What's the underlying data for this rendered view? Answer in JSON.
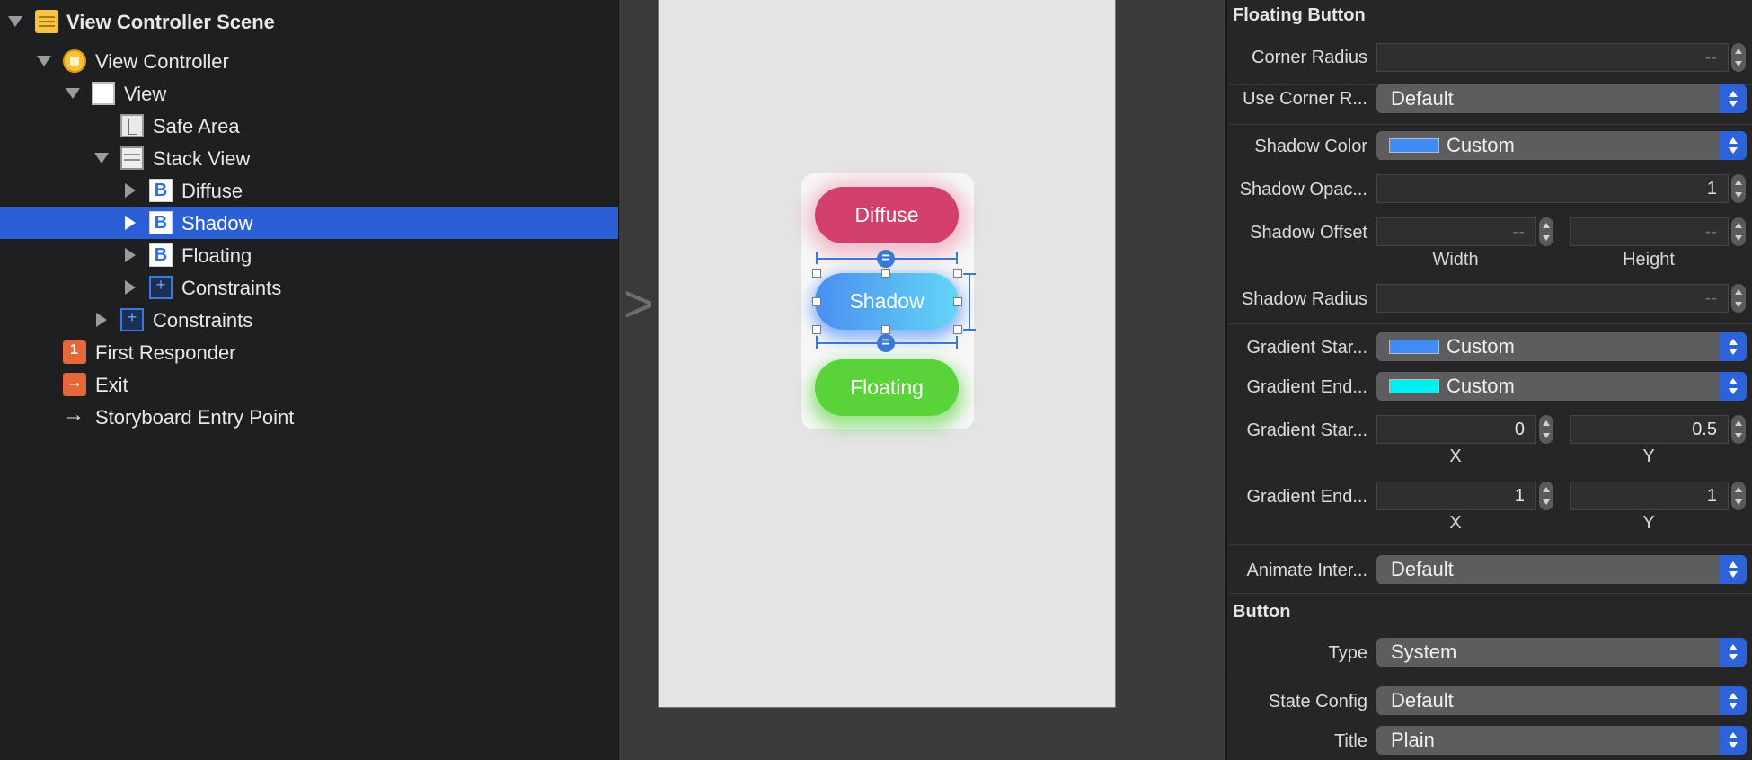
{
  "outline": {
    "items": [
      {
        "label": "View Controller Scene",
        "icon": "scene-icon"
      },
      {
        "label": "View Controller",
        "icon": "view-controller-icon"
      },
      {
        "label": "View",
        "icon": "view-icon"
      },
      {
        "label": "Safe Area",
        "icon": "safe-area-icon"
      },
      {
        "label": "Stack View",
        "icon": "stack-view-icon"
      },
      {
        "label": "Diffuse",
        "icon": "button-icon"
      },
      {
        "label": "Shadow",
        "icon": "button-icon",
        "selected": true
      },
      {
        "label": "Floating",
        "icon": "button-icon"
      },
      {
        "label": "Constraints",
        "icon": "constraints-icon"
      },
      {
        "label": "Constraints",
        "icon": "constraints-icon"
      },
      {
        "label": "First Responder",
        "icon": "first-responder-icon"
      },
      {
        "label": "Exit",
        "icon": "exit-icon"
      },
      {
        "label": "Storyboard Entry Point",
        "icon": "entry-arrow-icon"
      }
    ],
    "button_glyph": "B"
  },
  "canvas": {
    "buttons": {
      "diffuse": "Diffuse",
      "shadow": "Shadow",
      "floating": "Floating"
    },
    "colors": {
      "diffuse": "#d23f6a",
      "shadow_start": "#4a8ef0",
      "shadow_end": "#63d6f5",
      "floating": "#59d339"
    }
  },
  "inspector": {
    "floating_section": "Floating Button",
    "corner_radius": {
      "label": "Corner Radius",
      "value": "--"
    },
    "use_corner_radius": {
      "label": "Use Corner R...",
      "value": "Default"
    },
    "shadow_color": {
      "label": "Shadow Color",
      "value": "Custom",
      "swatch": "#3f8cf5"
    },
    "shadow_opacity": {
      "label": "Shadow Opac...",
      "value": "1"
    },
    "shadow_offset": {
      "label": "Shadow Offset",
      "width": "--",
      "height": "--",
      "width_label": "Width",
      "height_label": "Height"
    },
    "shadow_radius": {
      "label": "Shadow Radius",
      "value": "--"
    },
    "gradient_start_color": {
      "label": "Gradient Star...",
      "value": "Custom",
      "swatch": "#3f8cf5"
    },
    "gradient_end_color": {
      "label": "Gradient End...",
      "value": "Custom",
      "swatch": "#00f0f0"
    },
    "gradient_start_point": {
      "label": "Gradient Star...",
      "x": "0",
      "y": "0.5",
      "x_label": "X",
      "y_label": "Y"
    },
    "gradient_end_point": {
      "label": "Gradient End...",
      "x": "1",
      "y": "1",
      "x_label": "X",
      "y_label": "Y"
    },
    "animate_interaction": {
      "label": "Animate Inter...",
      "value": "Default"
    },
    "button_section": "Button",
    "type": {
      "label": "Type",
      "value": "System"
    },
    "state_config": {
      "label": "State Config",
      "value": "Default"
    },
    "title": {
      "label": "Title",
      "value": "Plain"
    }
  }
}
